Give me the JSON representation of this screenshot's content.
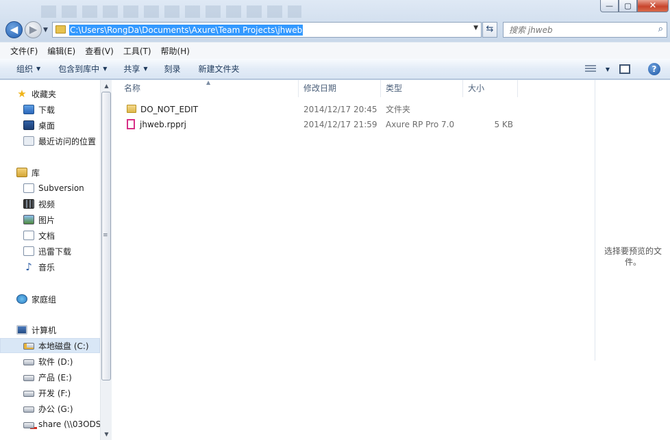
{
  "window": {
    "minimize_glyph": "—",
    "maximize_glyph": "▢",
    "close_glyph": "✕",
    "accent": "#3399ff"
  },
  "nav": {
    "back_glyph": "◀",
    "forward_glyph": "▶",
    "address_path": "C:\\Users\\RongDa\\Documents\\Axure\\Team Projects\\jhweb",
    "refresh_glyph": "⇆",
    "search_placeholder": "搜索 jhweb",
    "search_icon": "search-icon"
  },
  "menu": [
    "文件(F)",
    "编辑(E)",
    "查看(V)",
    "工具(T)",
    "帮助(H)"
  ],
  "toolbar": {
    "organize": "组织",
    "include_in_library": "包含到库中",
    "share": "共享",
    "burn": "刻录",
    "new_folder": "新建文件夹",
    "help_glyph": "?"
  },
  "sidebar": {
    "favorites": {
      "header": "收藏夹",
      "items": [
        "下载",
        "桌面",
        "最近访问的位置"
      ]
    },
    "libraries": {
      "header": "库",
      "items": [
        "Subversion",
        "视频",
        "图片",
        "文档",
        "迅雷下载",
        "音乐"
      ]
    },
    "homegroup": "家庭组",
    "computer": {
      "header": "计算机",
      "items": [
        "本地磁盘 (C:)",
        "软件 (D:)",
        "产品 (E:)",
        "开发 (F:)",
        "办公 (G:)",
        "share (\\\\03ODS"
      ],
      "selected_index": 0
    }
  },
  "columns": [
    "名称",
    "修改日期",
    "类型",
    "大小"
  ],
  "files": [
    {
      "name": "DO_NOT_EDIT",
      "modified": "2014/12/17 20:45",
      "type": "文件夹",
      "size": ""
    },
    {
      "name": "jhweb.rpprj",
      "modified": "2014/12/17 21:59",
      "type": "Axure RP Pro 7.0",
      "size": "5 KB"
    }
  ],
  "preview": {
    "message": "选择要预览的文件。"
  }
}
